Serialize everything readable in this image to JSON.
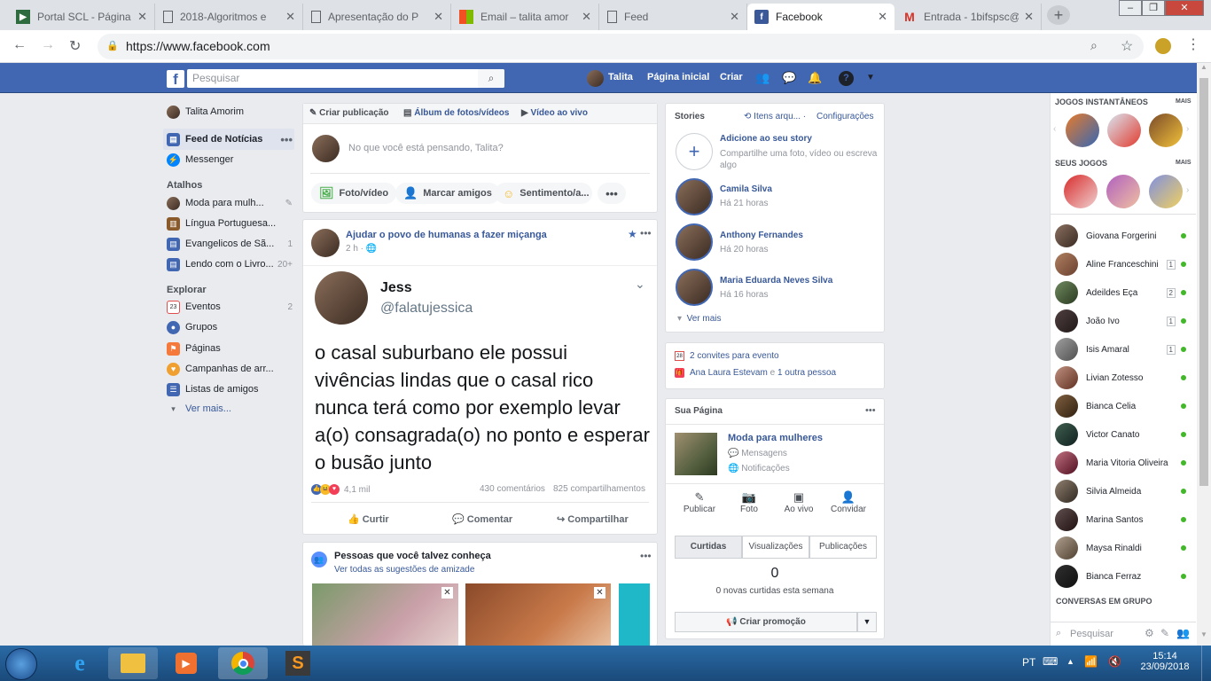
{
  "browser": {
    "tabs": [
      {
        "title": "Portal SCL - Página",
        "icon": "portal-icon",
        "active": false
      },
      {
        "title": "2018-Algoritmos e",
        "icon": "doc-icon",
        "active": false
      },
      {
        "title": "Apresentação do P",
        "icon": "doc-icon",
        "active": false
      },
      {
        "title": "Email – talita amor",
        "icon": "outlook-icon",
        "active": false
      },
      {
        "title": "Feed",
        "icon": "doc-icon",
        "active": false
      },
      {
        "title": "Facebook",
        "icon": "facebook-icon",
        "active": true
      },
      {
        "title": "Entrada - 1bifspsc@",
        "icon": "gmail-icon",
        "active": false
      }
    ],
    "url": "https://www.facebook.com"
  },
  "fb_header": {
    "search_placeholder": "Pesquisar",
    "user_name": "Talita",
    "home_label": "Página inicial",
    "create_label": "Criar"
  },
  "left_nav": {
    "profile_name": "Talita Amorim",
    "items": [
      {
        "label": "Feed de Notícias"
      },
      {
        "label": "Messenger"
      }
    ],
    "shortcuts_title": "Atalhos",
    "shortcuts": [
      {
        "label": "Moda para mulh...",
        "count": ""
      },
      {
        "label": "Língua Portuguesa...",
        "count": ""
      },
      {
        "label": "Evangelicos de Sã...",
        "count": "1"
      },
      {
        "label": "Lendo com o Livro...",
        "count": "20+"
      }
    ],
    "explore_title": "Explorar",
    "explore": [
      {
        "label": "Eventos",
        "count": "2"
      },
      {
        "label": "Grupos",
        "count": ""
      },
      {
        "label": "Páginas",
        "count": ""
      },
      {
        "label": "Campanhas de arr...",
        "count": ""
      },
      {
        "label": "Listas de amigos",
        "count": ""
      }
    ],
    "see_more": "Ver mais..."
  },
  "composer": {
    "tabs": [
      "Criar publicação",
      "Álbum de fotos/vídeos",
      "Vídeo ao vivo"
    ],
    "placeholder": "No que você está pensando, Talita?",
    "actions": [
      "Foto/vídeo",
      "Marcar amigos",
      "Sentimento/a..."
    ]
  },
  "post": {
    "group_title": "Ajudar o povo de humanas a fazer miçanga",
    "time": "2 h",
    "tweet_name": "Jess",
    "tweet_handle": "@falatujessica",
    "tweet_text": "o casal suburbano ele possui vivências lindas que o casal rico nunca terá como por exemplo levar a(o) consagrada(o) no ponto e esperar o busão junto",
    "reactions_count": "4,1 mil",
    "comments": "430 comentários",
    "shares": "825 compartilhamentos",
    "actions": [
      "Curtir",
      "Comentar",
      "Compartilhar"
    ]
  },
  "pymk": {
    "title": "Pessoas que você talvez conheça",
    "subtitle": "Ver todas as sugestões de amizade"
  },
  "stories": {
    "title": "Stories",
    "archive": "Itens arqu...",
    "settings": "Configurações",
    "add_title": "Adicione ao seu story",
    "add_sub": "Compartilhe uma foto, vídeo ou escreva algo",
    "items": [
      {
        "name": "Camila Silva",
        "time": "Há 21 horas"
      },
      {
        "name": "Anthony Fernandes",
        "time": "Há 20 horas"
      },
      {
        "name": "Maria Eduarda Neves Silva",
        "time": "Há 16 horas"
      }
    ],
    "see_more": "Ver mais"
  },
  "events": {
    "invites": "2 convites para evento",
    "birthday_name": "Ana Laura Estevam",
    "birthday_rest": " e ",
    "birthday_other": "1 outra pessoa"
  },
  "your_page": {
    "title": "Sua Página",
    "page_name": "Moda para mulheres",
    "messages": "Mensagens",
    "notifications": "Notificações",
    "actions": [
      "Publicar",
      "Foto",
      "Ao vivo",
      "Convidar"
    ],
    "tabs": [
      "Curtidas",
      "Visualizações",
      "Publicações"
    ],
    "likes_count": "0",
    "likes_caption": "0 novas curtidas esta semana",
    "promo": "Criar promoção"
  },
  "chat": {
    "instant_games": "JOGOS INSTANTÂNEOS",
    "your_games": "SEUS JOGOS",
    "more": "MAIS",
    "contacts": [
      {
        "name": "Giovana Forgerini",
        "badge": ""
      },
      {
        "name": "Aline Franceschini",
        "badge": "1"
      },
      {
        "name": "Adeildes Eça",
        "badge": "2"
      },
      {
        "name": "João Ivo",
        "badge": "1"
      },
      {
        "name": "Isis Amaral",
        "badge": "1"
      },
      {
        "name": "Livian Zotesso",
        "badge": ""
      },
      {
        "name": "Bianca Celia",
        "badge": ""
      },
      {
        "name": "Victor Canato",
        "badge": ""
      },
      {
        "name": "Maria Vitoria Oliveira",
        "badge": ""
      },
      {
        "name": "Silvia Almeida",
        "badge": ""
      },
      {
        "name": "Marina Santos",
        "badge": ""
      },
      {
        "name": "Maysa Rinaldi",
        "badge": ""
      },
      {
        "name": "Bianca Ferraz",
        "badge": ""
      }
    ],
    "group_title": "CONVERSAS EM GRUPO",
    "search_placeholder": "Pesquisar"
  },
  "taskbar": {
    "lang": "PT",
    "time": "15:14",
    "date": "23/09/2018"
  },
  "colors": {
    "fb_blue": "#4267b2",
    "link": "#385898",
    "online": "#42b72a"
  }
}
